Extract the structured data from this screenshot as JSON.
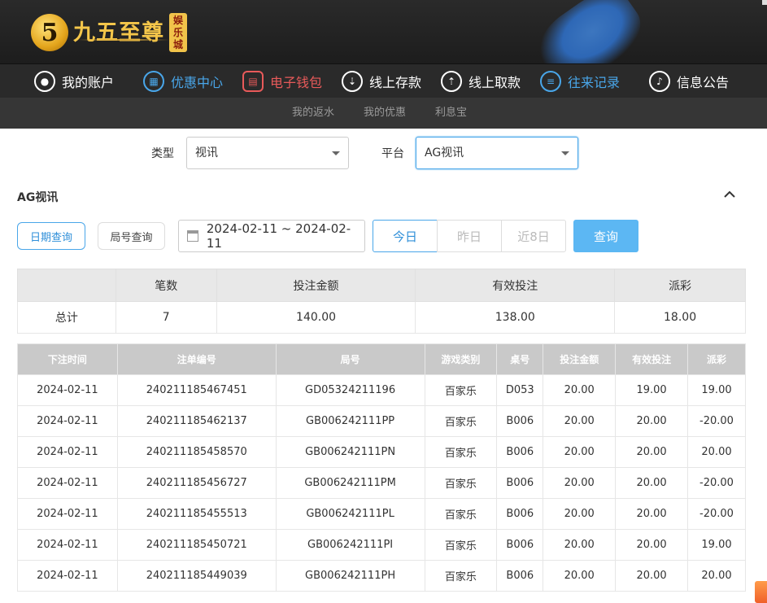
{
  "header": {
    "logo_mark": "5",
    "logo_text": "九五至尊",
    "logo_badge": "娱乐城"
  },
  "nav": [
    {
      "label": "我的账户",
      "icon": "user-icon",
      "color": "#ffffff"
    },
    {
      "label": "优惠中心",
      "icon": "gift-icon",
      "color": "#49a6e9"
    },
    {
      "label": "电子钱包",
      "icon": "wallet-icon",
      "color": "#e85a5a"
    },
    {
      "label": "线上存款",
      "icon": "deposit-icon",
      "color": "#ffffff"
    },
    {
      "label": "线上取款",
      "icon": "withdraw-icon",
      "color": "#ffffff"
    },
    {
      "label": "往来记录",
      "icon": "records-icon",
      "color": "#49a6e9"
    },
    {
      "label": "信息公告",
      "icon": "bell-icon",
      "color": "#ffffff"
    }
  ],
  "subnav": [
    "我的返水",
    "我的优惠",
    "利息宝"
  ],
  "filters": {
    "type_label": "类型",
    "type_value": "视讯",
    "platform_label": "平台",
    "platform_value": "AG视讯"
  },
  "section_title": "AG视讯",
  "query": {
    "date_query": "日期查询",
    "round_query": "局号查询",
    "date_range": "2024-02-11 ~ 2024-02-11",
    "today": "今日",
    "yesterday": "昨日",
    "last8": "近8日",
    "search": "查询"
  },
  "summary": {
    "headers": [
      "",
      "笔数",
      "投注金额",
      "有效投注",
      "派彩"
    ],
    "row": [
      "总计",
      "7",
      "140.00",
      "138.00",
      "18.00"
    ]
  },
  "detail": {
    "headers": [
      "下注时间",
      "注单编号",
      "局号",
      "游戏类别",
      "桌号",
      "投注金额",
      "有效投注",
      "派彩"
    ],
    "rows": [
      [
        "2024-02-11",
        "240211185467451",
        "GD05324211196",
        "百家乐",
        "D053",
        "20.00",
        "19.00",
        "19.00"
      ],
      [
        "2024-02-11",
        "240211185462137",
        "GB006242111PP",
        "百家乐",
        "B006",
        "20.00",
        "20.00",
        "-20.00"
      ],
      [
        "2024-02-11",
        "240211185458570",
        "GB006242111PN",
        "百家乐",
        "B006",
        "20.00",
        "20.00",
        "20.00"
      ],
      [
        "2024-02-11",
        "240211185456727",
        "GB006242111PM",
        "百家乐",
        "B006",
        "20.00",
        "20.00",
        "-20.00"
      ],
      [
        "2024-02-11",
        "240211185455513",
        "GB006242111PL",
        "百家乐",
        "B006",
        "20.00",
        "20.00",
        "-20.00"
      ],
      [
        "2024-02-11",
        "240211185450721",
        "GB006242111PI",
        "百家乐",
        "B006",
        "20.00",
        "20.00",
        "19.00"
      ],
      [
        "2024-02-11",
        "240211185449039",
        "GB006242111PH",
        "百家乐",
        "B006",
        "20.00",
        "20.00",
        "20.00"
      ]
    ]
  },
  "colors": {
    "accent": "#49a6e9",
    "negative": "#e0392b",
    "gold": "#f4c64a"
  }
}
